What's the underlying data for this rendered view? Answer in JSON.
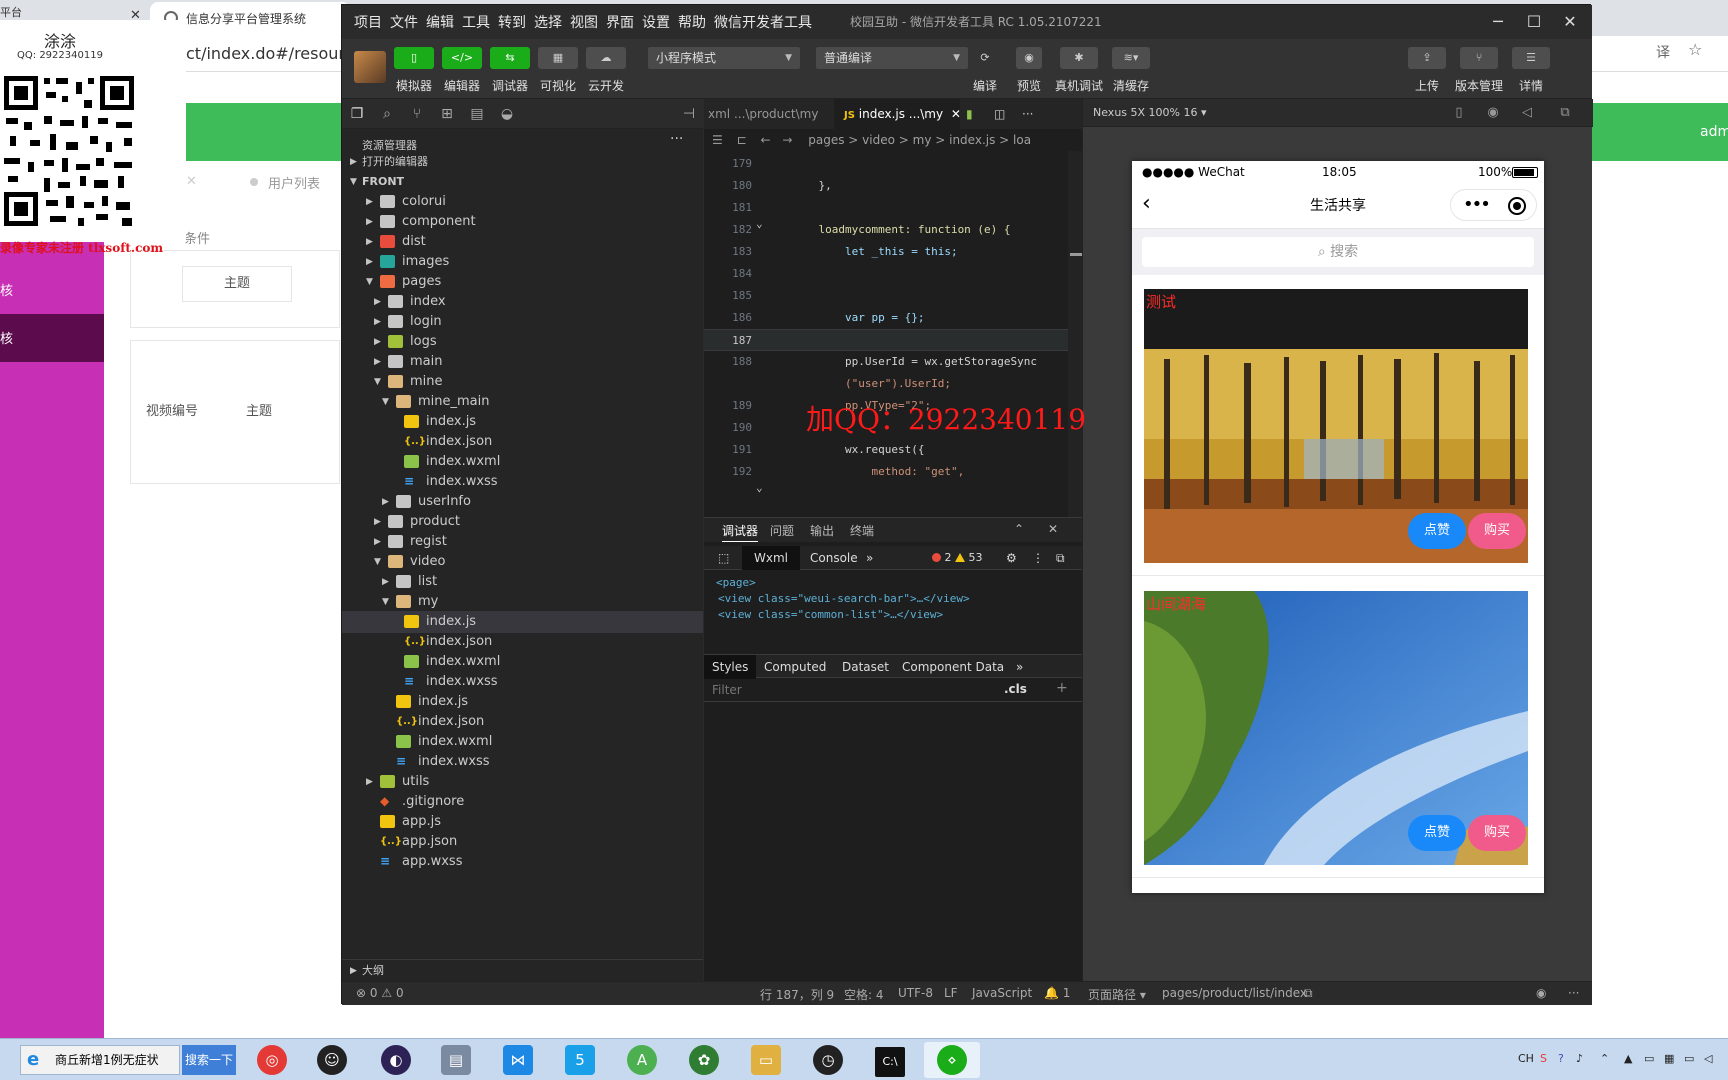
{
  "background_browser": {
    "tab_title": "信息分享平台管理系统",
    "url_fragment": "ct/index.do#/resources_",
    "header_right": "adm",
    "left_top_text": "平台",
    "sidebar_item1": "核",
    "sidebar_item2": "核",
    "tab_user_list": "用户列表",
    "condition_label": "条件",
    "theme_header": "主题",
    "col_video_no": "视频编号",
    "col_theme": "主题"
  },
  "qr_overlay": {
    "name": "涂涂",
    "qq": "QQ: 2922340119",
    "warning": "录像专家未注册 tlxsoft.com"
  },
  "devtools": {
    "menu": [
      "项目",
      "文件",
      "编辑",
      "工具",
      "转到",
      "选择",
      "视图",
      "界面",
      "设置",
      "帮助",
      "微信开发者工具"
    ],
    "window_title": "校园互助 - 微信开发者工具 RC 1.05.2107221",
    "toolbar": {
      "simulator": "模拟器",
      "editor": "编辑器",
      "debugger": "调试器",
      "visual": "可视化",
      "cloud": "云开发",
      "mode_select": "小程序模式",
      "compile_select": "普通编译",
      "compile": "编译",
      "preview": "预览",
      "real_debug": "真机调试",
      "clear_cache": "清缓存",
      "upload": "上传",
      "version": "版本管理",
      "details": "详情"
    },
    "explorer": {
      "title": "资源管理器",
      "open_editors": "打开的编辑器",
      "root": "FRONT",
      "outline": "大纲",
      "items": [
        {
          "name": "colorui",
          "depth": 1,
          "kind": "folder",
          "open": false
        },
        {
          "name": "component",
          "depth": 1,
          "kind": "folder",
          "open": false
        },
        {
          "name": "dist",
          "depth": 1,
          "kind": "red",
          "open": false
        },
        {
          "name": "images",
          "depth": 1,
          "kind": "teal",
          "open": false
        },
        {
          "name": "pages",
          "depth": 1,
          "kind": "orange",
          "open": true
        },
        {
          "name": "index",
          "depth": 2,
          "kind": "folder",
          "open": false
        },
        {
          "name": "login",
          "depth": 2,
          "kind": "folder",
          "open": false
        },
        {
          "name": "logs",
          "depth": 2,
          "kind": "lime",
          "open": false
        },
        {
          "name": "main",
          "depth": 2,
          "kind": "folder",
          "open": false
        },
        {
          "name": "mine",
          "depth": 2,
          "kind": "folder",
          "open": true
        },
        {
          "name": "mine_main",
          "depth": 3,
          "kind": "folder",
          "open": true
        },
        {
          "name": "index.js",
          "depth": 4,
          "kind": "js"
        },
        {
          "name": "index.json",
          "depth": 4,
          "kind": "json"
        },
        {
          "name": "index.wxml",
          "depth": 4,
          "kind": "wxml"
        },
        {
          "name": "index.wxss",
          "depth": 4,
          "kind": "wxss"
        },
        {
          "name": "userInfo",
          "depth": 3,
          "kind": "folder",
          "open": false
        },
        {
          "name": "product",
          "depth": 2,
          "kind": "folder",
          "open": false
        },
        {
          "name": "regist",
          "depth": 2,
          "kind": "folder",
          "open": false
        },
        {
          "name": "video",
          "depth": 2,
          "kind": "folder",
          "open": true
        },
        {
          "name": "list",
          "depth": 3,
          "kind": "folder",
          "open": false
        },
        {
          "name": "my",
          "depth": 3,
          "kind": "folder",
          "open": true
        },
        {
          "name": "index.js",
          "depth": 4,
          "kind": "js",
          "selected": true
        },
        {
          "name": "index.json",
          "depth": 4,
          "kind": "json"
        },
        {
          "name": "index.wxml",
          "depth": 4,
          "kind": "wxml"
        },
        {
          "name": "index.wxss",
          "depth": 4,
          "kind": "wxss"
        },
        {
          "name": "index.js",
          "depth": 3,
          "kind": "js"
        },
        {
          "name": "index.json",
          "depth": 3,
          "kind": "json"
        },
        {
          "name": "index.wxml",
          "depth": 3,
          "kind": "wxml"
        },
        {
          "name": "index.wxss",
          "depth": 3,
          "kind": "wxss"
        },
        {
          "name": "utils",
          "depth": 1,
          "kind": "lime",
          "open": false
        },
        {
          "name": ".gitignore",
          "depth": 1,
          "kind": "git"
        },
        {
          "name": "app.js",
          "depth": 1,
          "kind": "js"
        },
        {
          "name": "app.json",
          "depth": 1,
          "kind": "json"
        },
        {
          "name": "app.wxss",
          "depth": 1,
          "kind": "wxss"
        }
      ]
    },
    "editor": {
      "tab_inactive": "xml ...\\product\\my",
      "tab_active": "index.js ...\\my",
      "breadcrumb": "pages > video > my > index.js > loa",
      "lines": [
        {
          "no": "179",
          "code": ""
        },
        {
          "no": "180",
          "code": "    },"
        },
        {
          "no": "181",
          "code": ""
        },
        {
          "no": "182",
          "code": "    loadmycomment: function (e) {"
        },
        {
          "no": "183",
          "code": "        let _this = this;"
        },
        {
          "no": "184",
          "code": ""
        },
        {
          "no": "185",
          "code": ""
        },
        {
          "no": "186",
          "code": "        var pp = {};"
        },
        {
          "no": "187",
          "code": ""
        },
        {
          "no": "188",
          "code": "        pp.UserId = wx.getStorageSync"
        },
        {
          "no": "",
          "code": "        (\"user\").UserId;"
        },
        {
          "no": "189",
          "code": "        pp.VType=\"2\";"
        },
        {
          "no": "190",
          "code": ""
        },
        {
          "no": "191",
          "code": "        wx.request({"
        },
        {
          "no": "192",
          "code": "            method: \"get\","
        }
      ],
      "watermark": "加QQ：2922340119"
    },
    "debug": {
      "tabs": [
        "调试器",
        "问题",
        "输出",
        "终端"
      ],
      "subtabs": [
        "Wxml",
        "Console"
      ],
      "errors": "2",
      "warnings": "53",
      "wxml_lines": [
        "<page>",
        "<view class=\"weui-search-bar\">…</view>",
        "<view class=\"common-list\">…</view>"
      ],
      "style_tabs": [
        "Styles",
        "Computed",
        "Dataset",
        "Component Data"
      ],
      "filter_placeholder": "Filter",
      "cls": ".cls"
    },
    "simulator": {
      "device": "Nexus 5X 100% 16 ▾",
      "carrier": "●●●●● WeChat",
      "time": "18:05",
      "battery": "100%",
      "nav_title": "生活共享",
      "search_placeholder": "搜索",
      "cards": [
        {
          "title": "测试",
          "like": "点赞",
          "buy": "购买"
        },
        {
          "title": "山间湖海",
          "like": "点赞",
          "buy": "购买"
        }
      ]
    },
    "status": {
      "errors": "0",
      "warnings": "0",
      "position": "行 187，列 9",
      "spaces": "空格: 4",
      "encoding": "UTF-8",
      "eol": "LF",
      "language": "JavaScript",
      "notify": "1",
      "page_path_label": "页面路径 ▾",
      "page_path": "pages/product/list/index"
    }
  },
  "taskbar": {
    "ie_text": "商丘新增1例无症状",
    "search_btn": "搜索一下",
    "tray_lang": "CH"
  }
}
